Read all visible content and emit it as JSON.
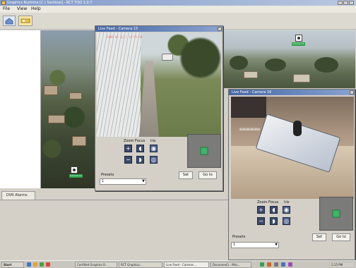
{
  "window": {
    "title": "Graphics Runtime [C:\\ Sentinel] - RCT TOD 1.0.7"
  },
  "menu": {
    "items": [
      "File",
      "View",
      "Help"
    ]
  },
  "camera1": {
    "title": "Live Feed - Camera 15",
    "overlay": "2008 02 12 | 14:55:20",
    "labels": {
      "zoom": "Zoom",
      "focus": "Focus",
      "iris": "Iris"
    },
    "presets_label": "Presets",
    "preset_value": "1",
    "set_label": "Set",
    "goto_label": "Go to"
  },
  "camera2": {
    "title": "Live Feed - Camera 16",
    "overlay": "000000000000",
    "labels": {
      "zoom": "Zoom",
      "focus": "Focus",
      "iris": "Iris"
    },
    "presets_label": "Presets",
    "preset_value": "1",
    "set_label": "Set",
    "goto_label": "Go to"
  },
  "bottom": {
    "tab_label": "DVR Alarms"
  },
  "markers": [
    {
      "label": "Camera 12"
    },
    {
      "label": "Camera 14"
    }
  ],
  "taskbar": {
    "start_label": "Start",
    "items": [
      "Certified Graphics R...",
      "RCT Graphics...",
      "Live Feed - Camera ...",
      "Document1 - Micr..."
    ],
    "clock": "2:15 PM"
  },
  "colors": {
    "title_bar": "#4566a4",
    "marker_label": "#2da14b",
    "preview_square": "#3fb46a"
  }
}
